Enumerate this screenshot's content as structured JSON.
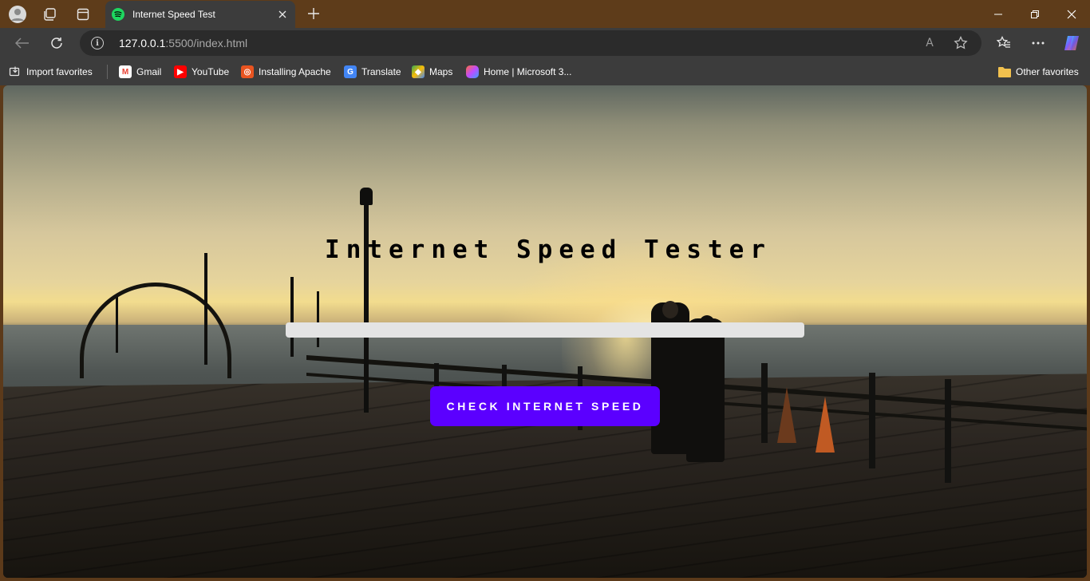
{
  "browser": {
    "tab": {
      "title": "Internet Speed Test",
      "favicon": "spotify-icon"
    },
    "address_bar": {
      "host": "127.0.0.1",
      "path": ":5500/index.html"
    },
    "bookmarks": [
      {
        "label": "Import favorites",
        "icon": "import-icon"
      },
      {
        "label": "Gmail",
        "icon": "gmail-icon",
        "color": "#ea4335"
      },
      {
        "label": "YouTube",
        "icon": "youtube-icon",
        "color": "#ff0000"
      },
      {
        "label": "Installing Apache",
        "icon": "ubuntu-icon",
        "color": "#e95420"
      },
      {
        "label": "Translate",
        "icon": "translate-icon",
        "color": "#4285f4"
      },
      {
        "label": "Maps",
        "icon": "maps-icon",
        "color": "#34a853"
      },
      {
        "label": "Home | Microsoft 3...",
        "icon": "microsoft365-icon",
        "color": "#7b61ff"
      }
    ],
    "other_favorites": "Other favorites",
    "translate_glyph": "A",
    "tab_glyph": "G"
  },
  "page": {
    "title": "Internet Speed Tester",
    "progress": {
      "value": 0
    },
    "button_label": "CHECK INTERNET SPEED",
    "colors": {
      "accent": "#5b00ff",
      "progress_track": "#e4e4e4"
    }
  }
}
